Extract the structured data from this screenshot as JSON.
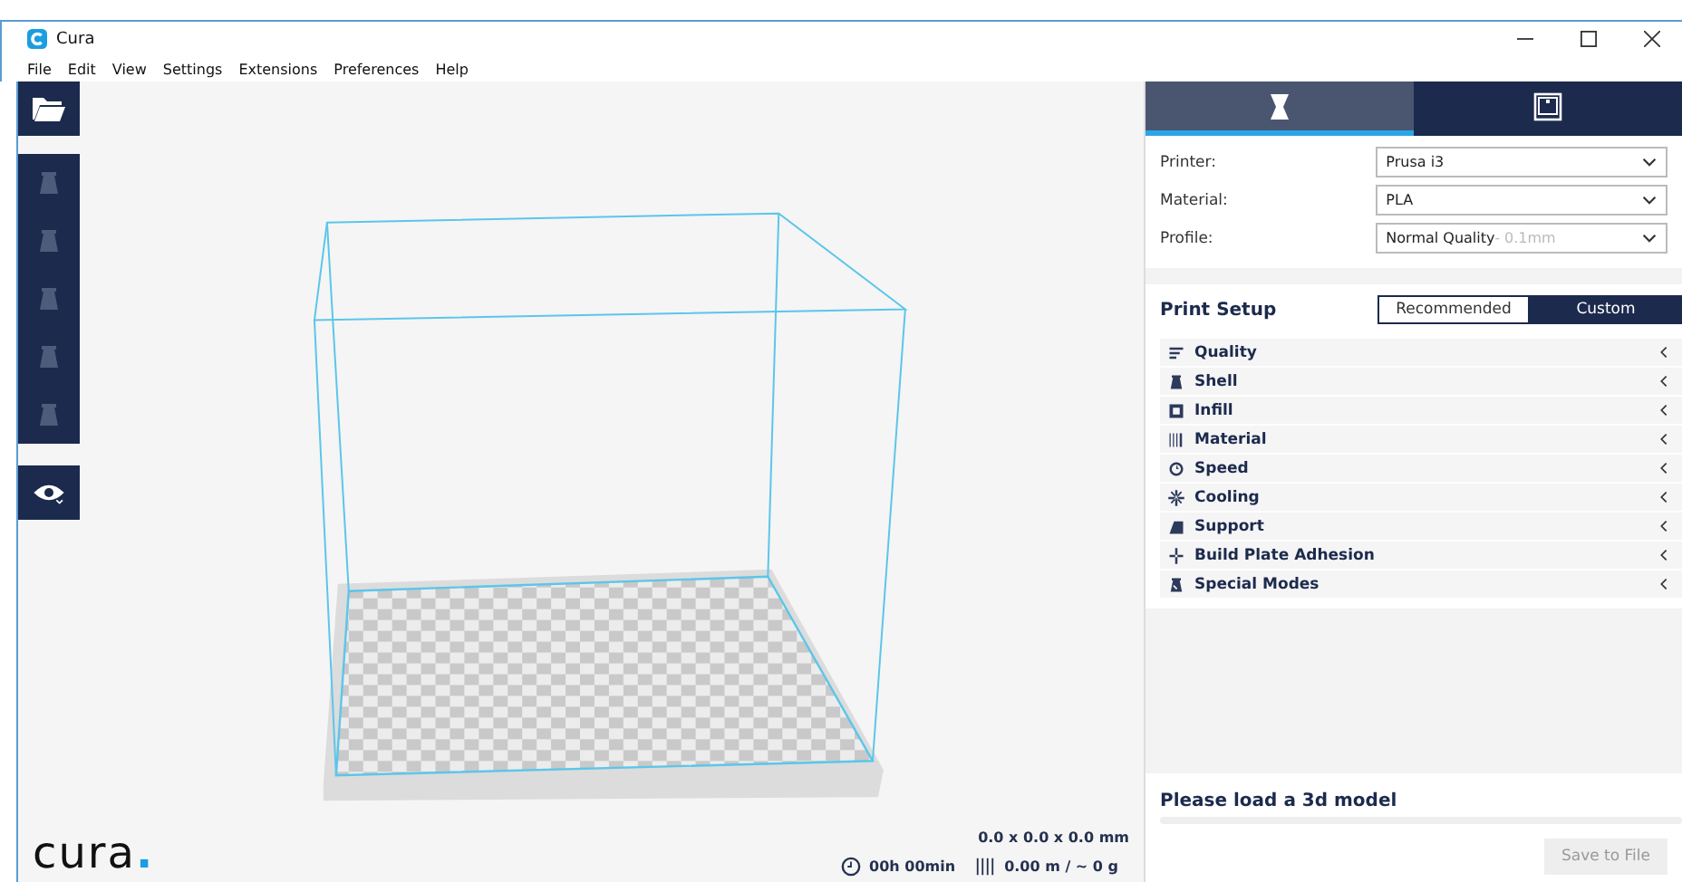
{
  "window": {
    "title": "Cura"
  },
  "menu": [
    "File",
    "Edit",
    "View",
    "Settings",
    "Extensions",
    "Preferences",
    "Help"
  ],
  "tools": [
    {
      "disabled": true
    },
    {
      "disabled": true
    },
    {
      "disabled": true
    },
    {
      "disabled": true
    },
    {
      "disabled": true
    }
  ],
  "sidebar_tabs": [
    {
      "selected": true
    },
    {
      "selected": false
    }
  ],
  "fields": [
    {
      "label": "Printer:",
      "value": "Prusa i3"
    },
    {
      "label": "Material:",
      "value": "PLA"
    },
    {
      "label": "Profile:",
      "value": "Normal Quality",
      "hint": "- 0.1mm"
    }
  ],
  "print_setup": {
    "title": "Print Setup",
    "modes": [
      {
        "label": "Recommended",
        "selected": false
      },
      {
        "label": "Custom",
        "selected": true
      }
    ]
  },
  "categories": [
    "Quality",
    "Shell",
    "Infill",
    "Material",
    "Speed",
    "Cooling",
    "Support",
    "Build Plate Adhesion",
    "Special Modes"
  ],
  "logo": "cura.",
  "dimensions": "0.0 x 0.0 x 0.0 mm",
  "print_time": "00h 00min",
  "material_usage": "0.00 m / ~ 0 g",
  "status": {
    "message": "Please load a 3d model",
    "level": 0
  },
  "save_button": {
    "label": "Save to File",
    "disabled": true
  }
}
